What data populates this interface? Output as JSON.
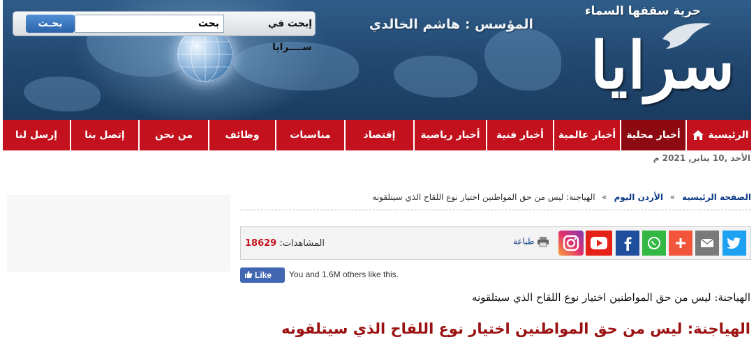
{
  "header": {
    "tagline": "حرية سقفها السماء",
    "logo_text": "سرايا",
    "founder": "المؤسس : هاشم الخالدي",
    "search": {
      "label": "إبحث في ســــرايا",
      "input_value": "بحث",
      "button_label": "بحـث"
    }
  },
  "nav": {
    "items": [
      {
        "label": "الرئيسية",
        "icon": "home-icon"
      },
      {
        "label": "أخبار محلية",
        "active": true
      },
      {
        "label": "أخبار عالمية"
      },
      {
        "label": "أخبار فنية"
      },
      {
        "label": "أخبار رياضية"
      },
      {
        "label": "إقتصاد"
      },
      {
        "label": "مناسبات"
      },
      {
        "label": "وظائف"
      },
      {
        "label": "من نحن"
      },
      {
        "label": "إتصل بنا"
      },
      {
        "label": "إرسل لنا"
      }
    ]
  },
  "date": "الأحد ,10 يناير, 2021 م",
  "breadcrumb": {
    "home": "الصفحة الرئيسية",
    "section": "الأردن اليوم",
    "separator": "»",
    "current": "الهياجنة: ليس من حق المواطنين اختيار نوع اللقاح الذي سيتلقونه"
  },
  "share": {
    "buttons": [
      {
        "name": "twitter-icon",
        "color": "#1da1f2"
      },
      {
        "name": "email-icon",
        "color": "#7a7a7a"
      },
      {
        "name": "plus-icon",
        "color": "#f2553b"
      },
      {
        "name": "whatsapp-icon",
        "color": "#32b843"
      },
      {
        "name": "facebook-icon",
        "color": "#1f4e9c"
      },
      {
        "name": "youtube-icon",
        "color": "#e62117"
      },
      {
        "name": "instagram-icon",
        "color": "#c13584"
      }
    ],
    "print_label": "طباعة",
    "views_label": "المشاهدات:",
    "views_count": "18629"
  },
  "facebook": {
    "like_label": "Like",
    "like_text": "You and 1.6M others like this."
  },
  "article": {
    "subtitle": "الهياجنة: ليس من حق المواطنين اختيار نوع اللقاح الذي سيتلقونه",
    "headline": "الهياجنة: ليس من حق المواطنين اختيار نوع اللقاح الذي سيتلقونه"
  },
  "colors": {
    "nav_red": "#c3111d",
    "nav_active": "#8e0a12",
    "header_blue": "#234a73",
    "headline_red": "#9b1111",
    "link_blue": "#0d3b85"
  }
}
